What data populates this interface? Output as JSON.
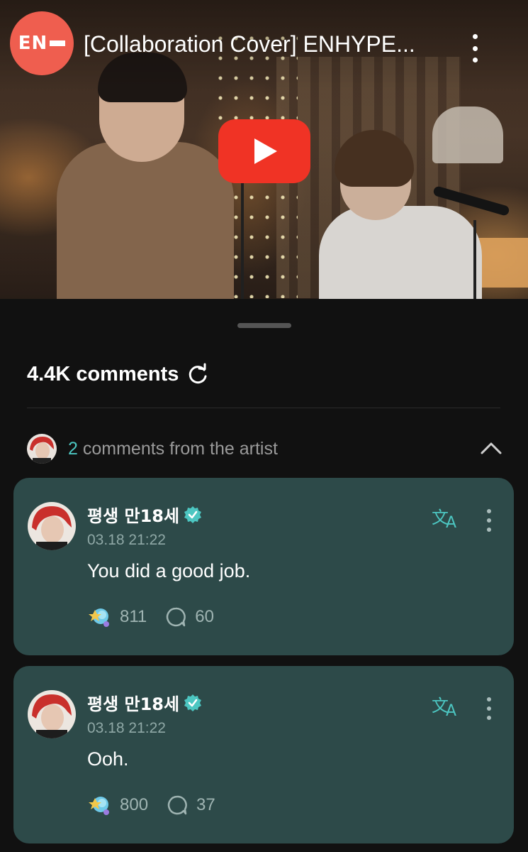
{
  "video": {
    "channel_logo_text": "EN",
    "title": "[Collaboration Cover] ENHYPE..."
  },
  "comments": {
    "count_label": "4.4K comments",
    "artist_row": {
      "count": "2",
      "label": "comments from the artist"
    },
    "items": [
      {
        "author": "평생 만18세",
        "timestamp": "03.18 21:22",
        "text": "You did a good job.",
        "reactions": "811",
        "replies": "60"
      },
      {
        "author": "평생 만18세",
        "timestamp": "03.18 21:22",
        "text": "Ooh.",
        "reactions": "800",
        "replies": "37"
      }
    ]
  },
  "colors": {
    "background": "#111111",
    "card": "#2d4a49",
    "accent": "#4cc6c1",
    "play_button": "#f03325",
    "channel_logo": "#ef5e4f"
  }
}
